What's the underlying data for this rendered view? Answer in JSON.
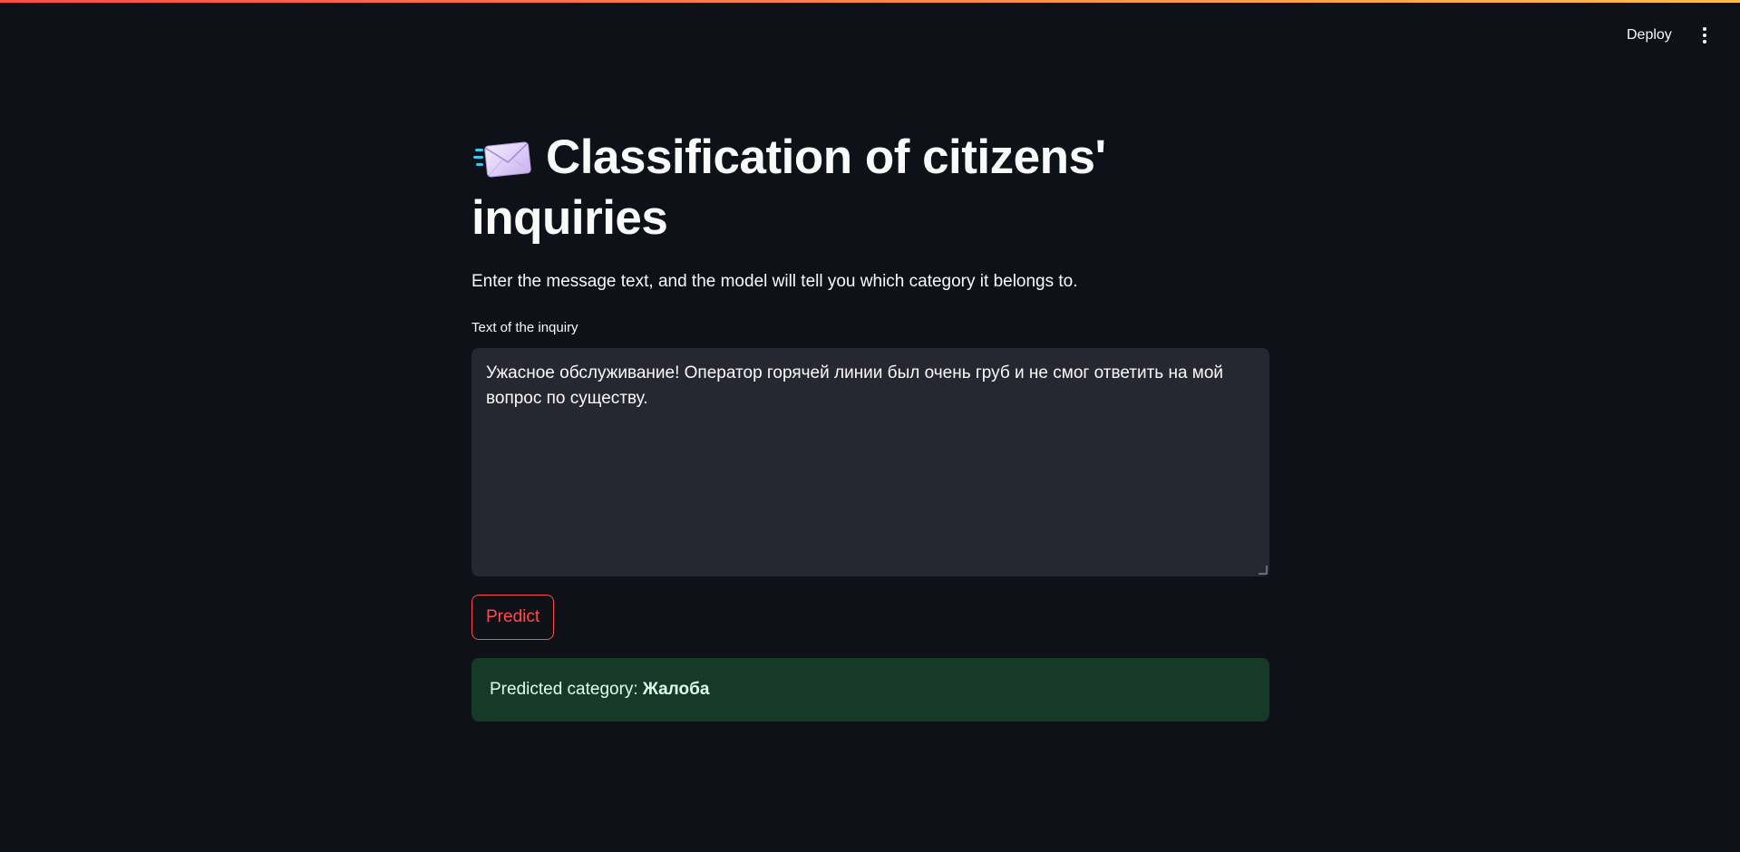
{
  "header": {
    "deploy_label": "Deploy",
    "menu_icon": "kebab-menu-icon"
  },
  "main": {
    "title_icon": "incoming-envelope-emoji",
    "title": "Classification of citizens' inquiries",
    "subtitle": "Enter the message text, and the model will tell you which category it belongs to.",
    "input": {
      "label": "Text of the inquiry",
      "value": "Ужасное обслуживание! Оператор горячей линии был очень груб и не смог ответить на мой вопрос по существу."
    },
    "predict_label": "Predict",
    "result": {
      "prefix": "Predicted category:",
      "value": "Жалоба"
    }
  },
  "colors": {
    "background": "#0e1117",
    "accent": "#ff4b4b",
    "success_bg": "#173928",
    "input_bg": "#262730"
  }
}
